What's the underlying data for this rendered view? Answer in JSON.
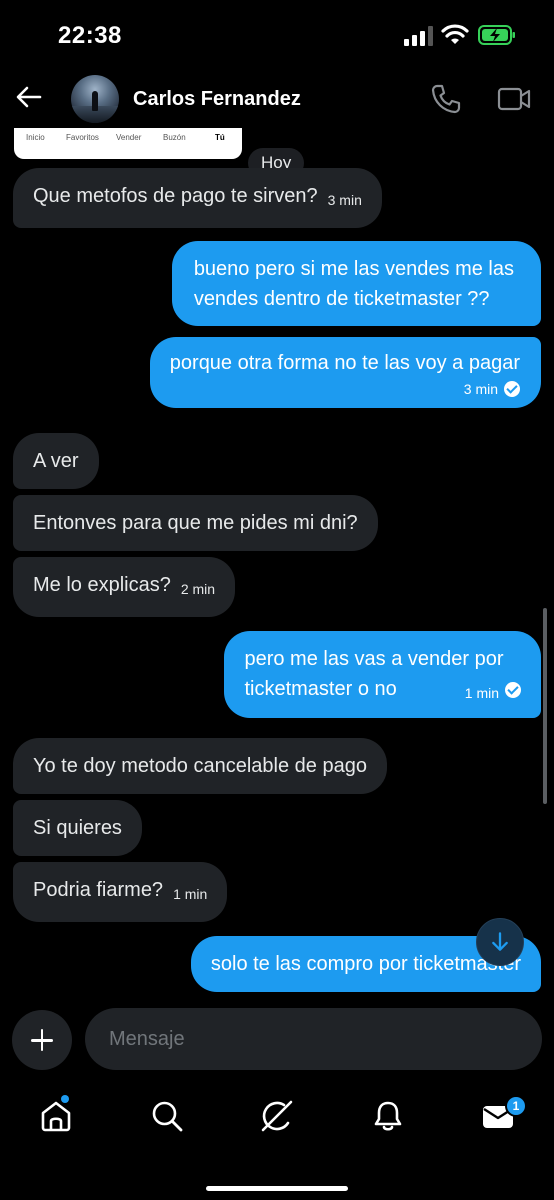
{
  "status_bar": {
    "time": "22:38"
  },
  "header": {
    "contact_name": "Carlos Fernandez"
  },
  "preview_card": {
    "tabs": [
      "Inicio",
      "Favoritos",
      "Vender",
      "Buzón",
      "Tú"
    ]
  },
  "day_divider": "Hoy",
  "messages": [
    {
      "dir": "in",
      "text": "Que metofos de pago te sirven?",
      "time": "3 min"
    },
    {
      "dir": "out",
      "lines": [
        "bueno pero si me las vendes me las",
        "vendes dentro de ticketmaster ??"
      ]
    },
    {
      "dir": "out",
      "text": "porque otra forma no te las voy a pagar",
      "time": "3 min"
    },
    {
      "dir": "in",
      "text": "A ver"
    },
    {
      "dir": "in",
      "text": "Entonves para que me pides mi dni?"
    },
    {
      "dir": "in",
      "text": "Me lo explicas?",
      "time": "2 min"
    },
    {
      "dir": "out",
      "lines": [
        "pero me las vas a vender por",
        "ticketmaster o no"
      ],
      "time": "1 min"
    },
    {
      "dir": "in",
      "text": "Yo te doy metodo cancelable de pago"
    },
    {
      "dir": "in",
      "text": "Si quieres"
    },
    {
      "dir": "in",
      "text": "Podria fiarme?",
      "time": "1 min"
    },
    {
      "dir": "out",
      "text": "solo te las compro por ticketmaster"
    }
  ],
  "composer": {
    "placeholder": "Mensaje"
  },
  "bottom_nav": {
    "items": [
      "home-icon",
      "search-icon",
      "grok-icon",
      "notifications-icon",
      "messages-icon"
    ],
    "messages_badge": "1"
  },
  "colors": {
    "accent": "#1d9bf0",
    "incoming_bubble": "#202327",
    "background": "#000000"
  }
}
